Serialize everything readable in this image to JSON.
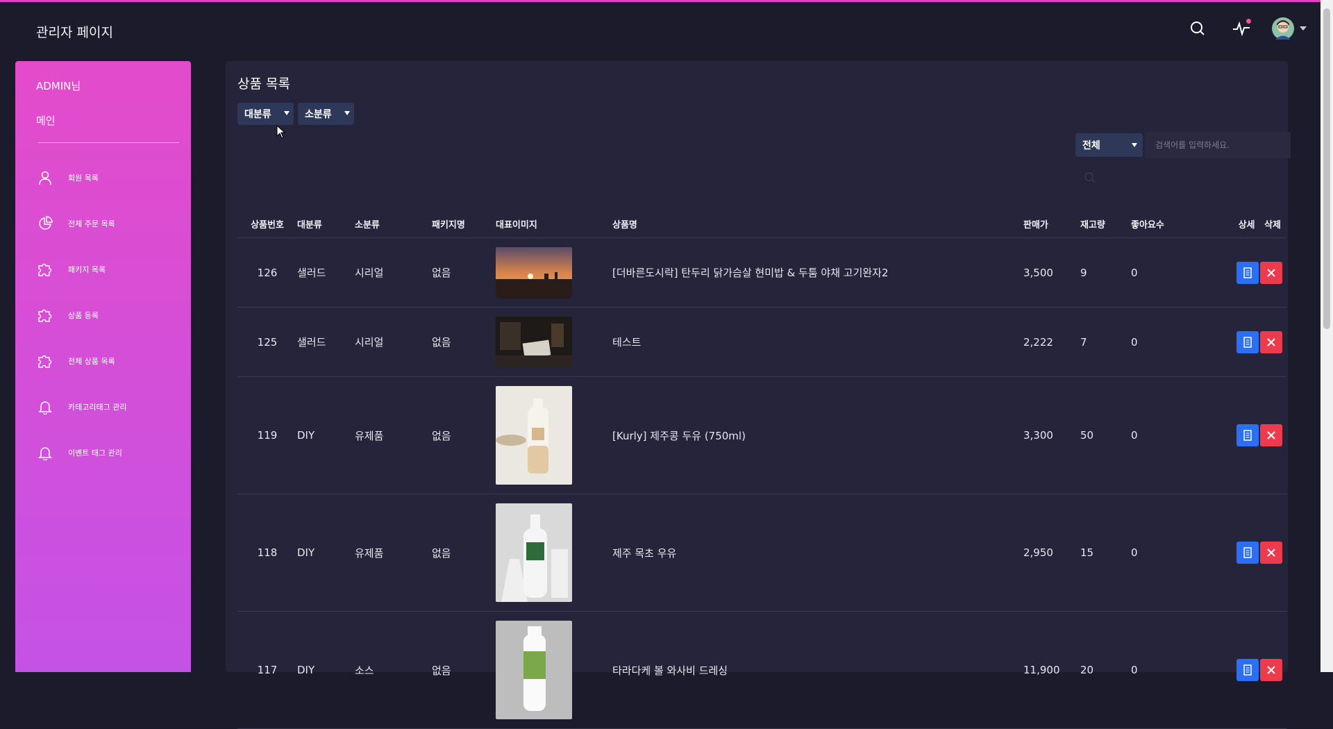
{
  "app": {
    "title": "관리자 페이지"
  },
  "colors": {
    "accent": "#e13fc8",
    "sidebar_top": "#e34bca",
    "sidebar_bottom": "#c552e6",
    "detail_button": "#2a6ff5",
    "delete_button": "#ee3a4d"
  },
  "header_icons": [
    "search-icon",
    "activity-icon",
    "avatar"
  ],
  "sidebar": {
    "user_label": "ADMIN님",
    "main_label": "메인",
    "items": [
      {
        "label": "회원 목록",
        "icon": "user-icon"
      },
      {
        "label": "전체 주문 목록",
        "icon": "pie-chart-icon"
      },
      {
        "label": "패키지 목록",
        "icon": "puzzle-icon"
      },
      {
        "label": "상품 등록",
        "icon": "puzzle-icon"
      },
      {
        "label": "전체 상품 목록",
        "icon": "puzzle-icon"
      },
      {
        "label": "카테고리태그 관리",
        "icon": "bell-icon"
      },
      {
        "label": "이벤트 태그 관리",
        "icon": "bell-icon"
      }
    ]
  },
  "main": {
    "title": "상품 목록",
    "filters": {
      "major": "대분류",
      "minor": "소분류"
    },
    "search": {
      "scope": "전체",
      "placeholder": "검색어를 입력하세요."
    },
    "columns": [
      "상품번호",
      "대분류",
      "소분류",
      "패키지명",
      "대표이미지",
      "상품명",
      "판매가",
      "재고량",
      "좋아요수",
      "상세",
      "삭제"
    ],
    "rows": [
      {
        "id": "126",
        "major": "샐러드",
        "minor": "시리얼",
        "package": "없음",
        "image": "sunset",
        "name": "[더바른도시락] 탄두리 닭가슴살 현미밥 & 두툼 야채 고기완자2",
        "price": "3,500",
        "stock": "9",
        "likes": "0"
      },
      {
        "id": "125",
        "major": "샐러드",
        "minor": "시리얼",
        "package": "없음",
        "image": "books",
        "name": "테스트",
        "price": "2,222",
        "stock": "7",
        "likes": "0"
      },
      {
        "id": "119",
        "major": "DIY",
        "minor": "유제품",
        "package": "없음",
        "image": "soy-milk",
        "name": "[Kurly] 제주콩 두유 (750ml)",
        "price": "3,300",
        "stock": "50",
        "likes": "0"
      },
      {
        "id": "118",
        "major": "DIY",
        "minor": "유제품",
        "package": "없음",
        "image": "milk",
        "name": "제주 목초 우유",
        "price": "2,950",
        "stock": "15",
        "likes": "0"
      },
      {
        "id": "117",
        "major": "DIY",
        "minor": "소스",
        "package": "없음",
        "image": "dressing",
        "name": "타라다케 볼 와사비 드레싱",
        "price": "11,900",
        "stock": "20",
        "likes": "0"
      }
    ]
  }
}
